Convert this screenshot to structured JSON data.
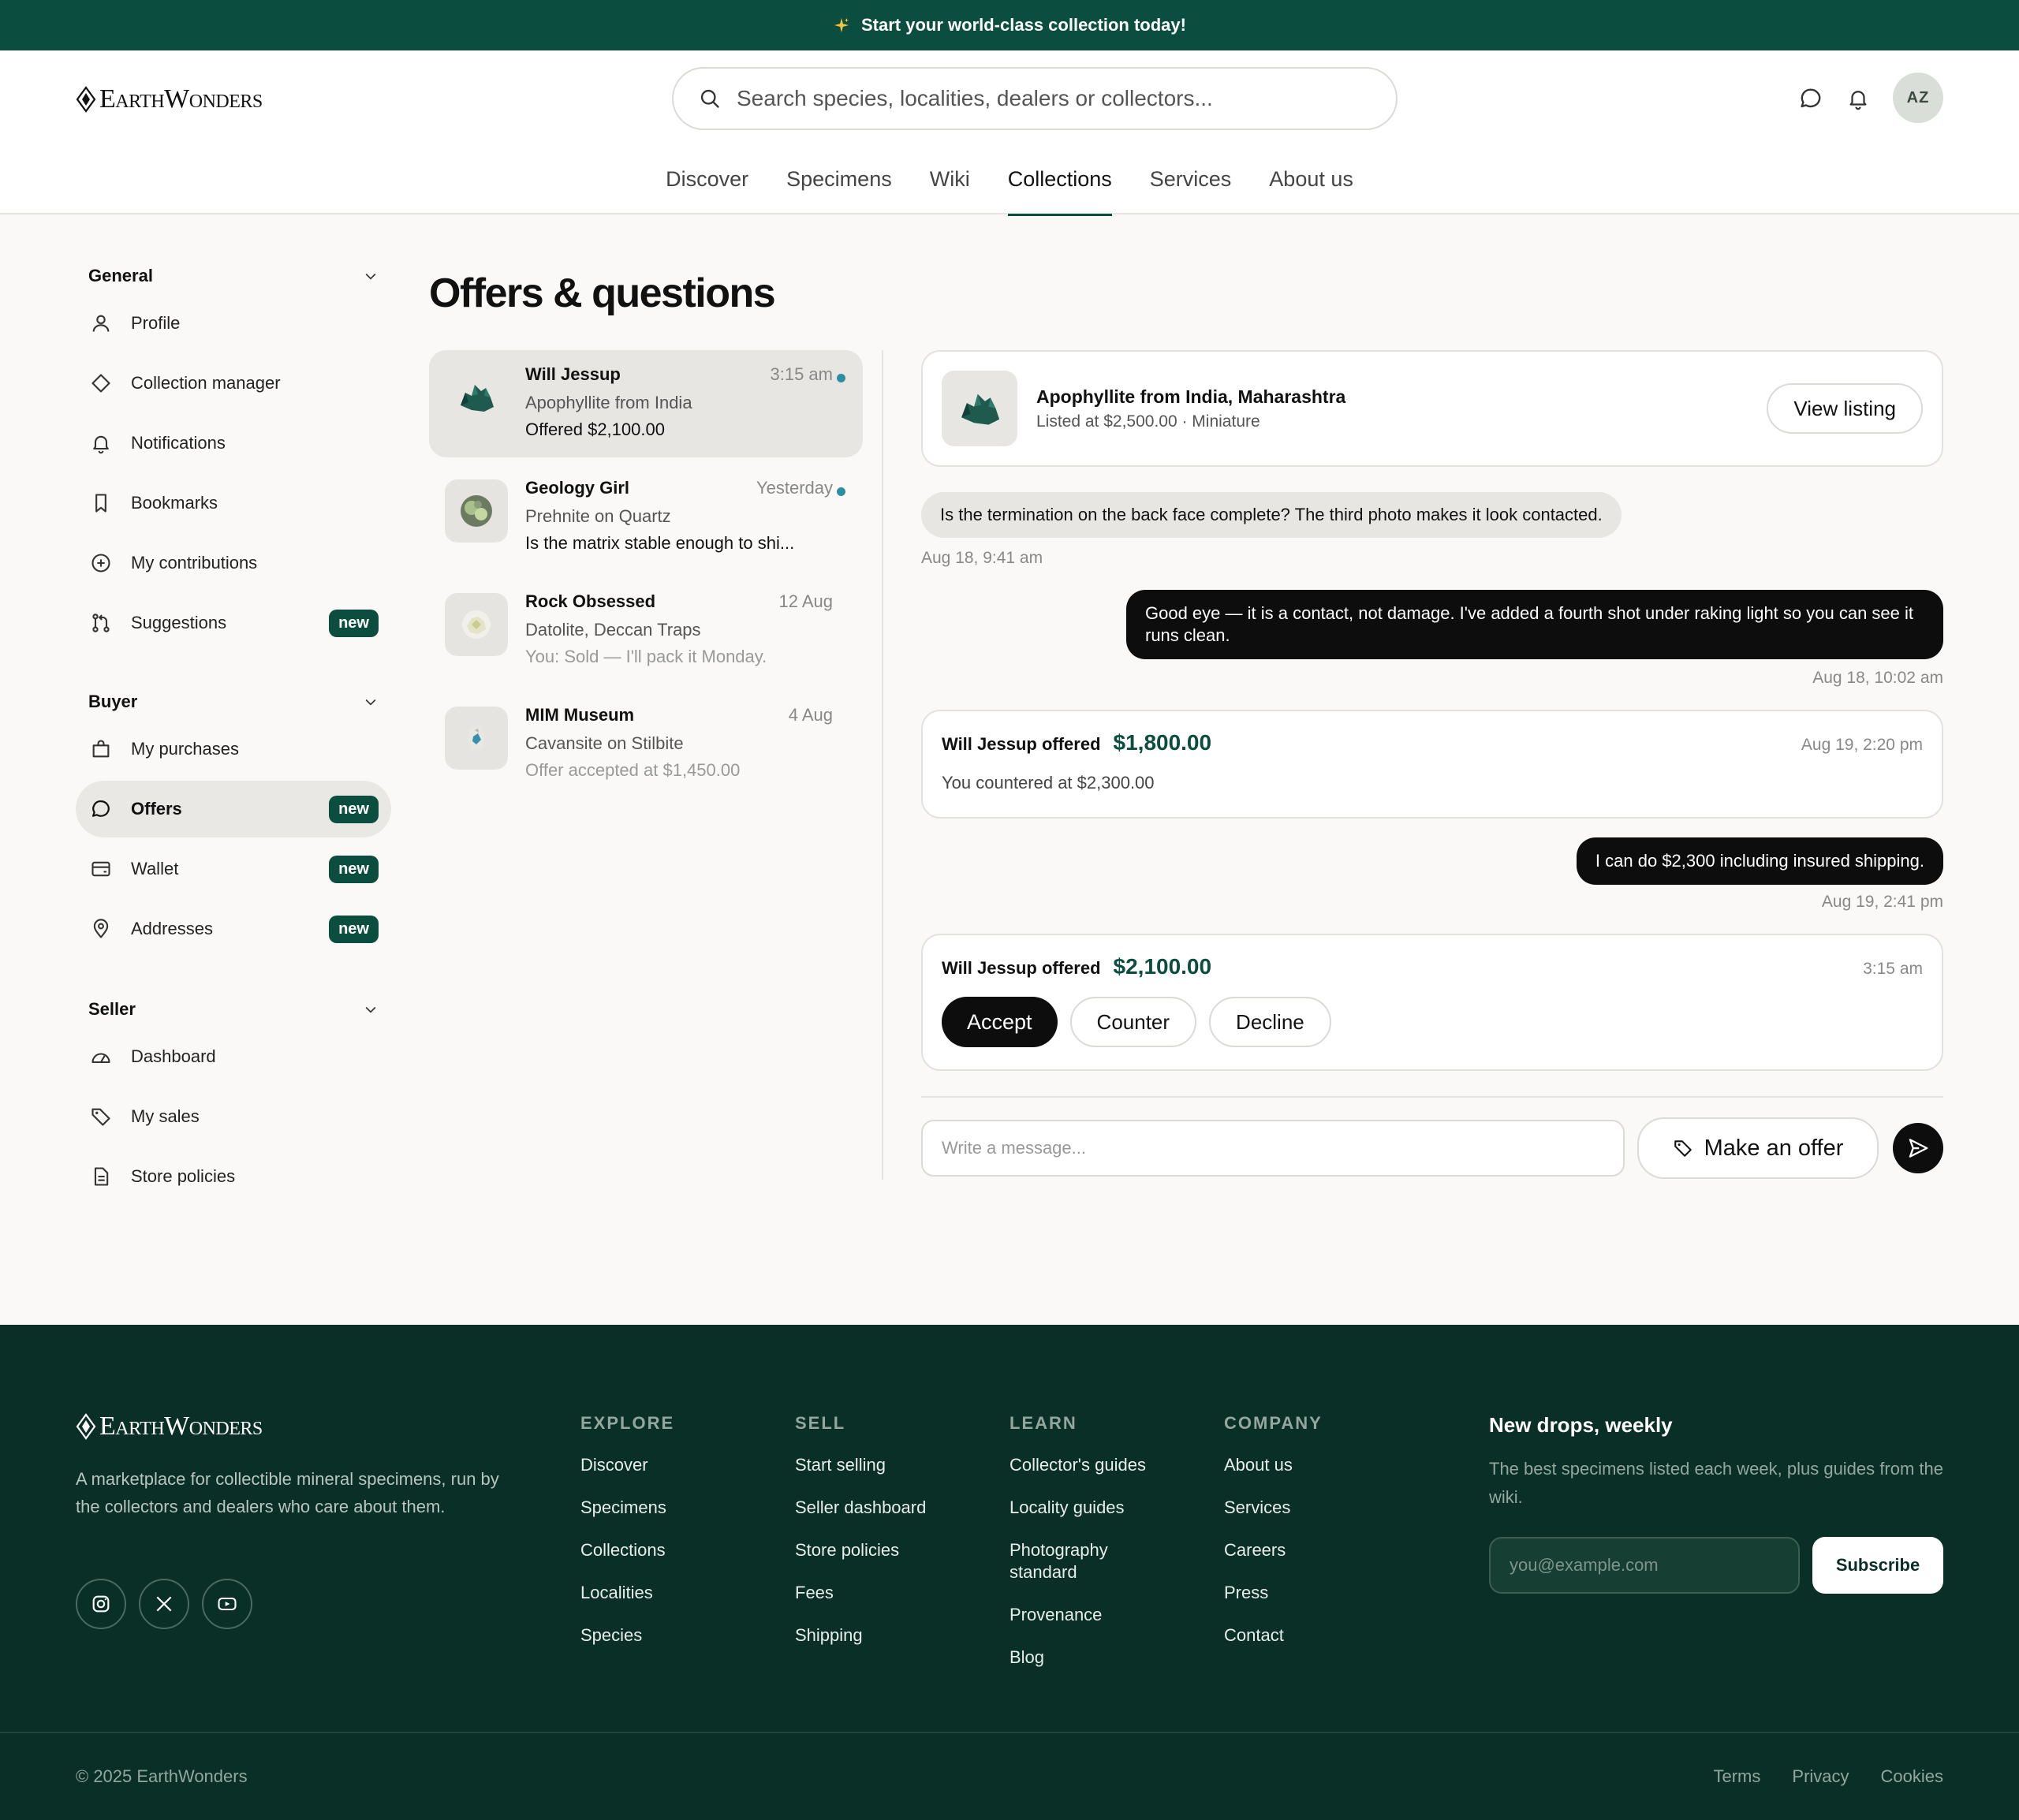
{
  "promo": {
    "text": "Start your world-class collection today!"
  },
  "brand": {
    "name": "EarthWonders"
  },
  "search": {
    "placeholder": "Search species, localities, dealers or collectors..."
  },
  "user": {
    "initials": "AZ"
  },
  "topnav": [
    "Discover",
    "Specimens",
    "Wiki",
    "Collections",
    "Services",
    "About us"
  ],
  "topnav_active": "Collections",
  "sidebar": {
    "general": {
      "title": "General",
      "items": [
        "Profile",
        "Collection manager",
        "Notifications",
        "Bookmarks",
        "My contributions",
        "Suggestions"
      ]
    },
    "buyer": {
      "title": "Buyer",
      "items": [
        "My purchases",
        "Offers",
        "Wallet",
        "Addresses"
      ]
    },
    "seller": {
      "title": "Seller",
      "items": [
        "Dashboard",
        "My sales",
        "Store policies"
      ]
    },
    "badge": "new"
  },
  "page": {
    "title": "Offers & questions"
  },
  "threads": [
    {
      "name": "Will Jessup",
      "time": "3:15 am",
      "subject": "Apophyllite from India",
      "last": "Offered $2,100.00",
      "unread": true
    },
    {
      "name": "Geology Girl",
      "time": "Yesterday",
      "subject": "Prehnite on Quartz",
      "last": "Is the matrix stable enough to shi...",
      "unread": true
    },
    {
      "name": "Rock Obsessed",
      "time": "12 Aug",
      "subject": "Datolite, Deccan Traps",
      "last": "You: Sold — I'll pack it Monday.",
      "unread": false
    },
    {
      "name": "MIM Museum",
      "time": "4 Aug",
      "subject": "Cavansite on Stilbite",
      "last": "Offer accepted at $1,450.00",
      "unread": false
    }
  ],
  "listing": {
    "title": "Apophyllite from India, Maharashtra",
    "meta": "Listed at $2,500.00 · Miniature",
    "button": "View listing"
  },
  "conversation": {
    "q1": {
      "text": "Is the termination on the back face complete? The third photo makes it look contacted.",
      "time": "Aug 18, 9:41 am"
    },
    "a1": {
      "text": "Good eye — it is a contact, not damage. I've added a fourth shot under raking light so you can see it runs clean.",
      "time": "Aug 18, 10:02 am"
    },
    "offer1": {
      "who": "Will Jessup offered",
      "amount": "$1,800.00",
      "time": "Aug 19, 2:20 pm",
      "note": "You countered at $2,300.00"
    },
    "a2": {
      "text": "I can do $2,300 including insured shipping.",
      "time": "Aug 19, 2:41 pm"
    },
    "offer2": {
      "who": "Will Jessup offered",
      "amount": "$2,100.00",
      "time": "3:15 am",
      "accept": "Accept",
      "counter": "Counter",
      "decline": "Decline"
    }
  },
  "composer": {
    "placeholder": "Write a message...",
    "offer_button": "Make an offer"
  },
  "footer": {
    "tagline": "A marketplace for collectible mineral specimens, run by the collectors and dealers who care about them.",
    "columns": [
      {
        "title": "EXPLORE",
        "links": [
          "Discover",
          "Specimens",
          "Collections",
          "Localities",
          "Species"
        ]
      },
      {
        "title": "SELL",
        "links": [
          "Start selling",
          "Seller dashboard",
          "Store policies",
          "Fees",
          "Shipping"
        ]
      },
      {
        "title": "LEARN",
        "links": [
          "Collector's guides",
          "Locality guides",
          "Photography standard",
          "Provenance",
          "Blog"
        ]
      },
      {
        "title": "COMPANY",
        "links": [
          "About us",
          "Services",
          "Careers",
          "Press",
          "Contact"
        ]
      }
    ],
    "newsletter": {
      "title": "New drops, weekly",
      "text": "The best specimens listed each week, plus guides from the wiki.",
      "placeholder": "you@example.com",
      "button": "Subscribe"
    },
    "copyright": "© 2025 EarthWonders",
    "legal": [
      "Terms",
      "Privacy",
      "Cookies"
    ]
  },
  "colors": {
    "brand": "#0b4d3e",
    "footer": "#0a2f26",
    "unread_dot": "#2a8fa3"
  }
}
